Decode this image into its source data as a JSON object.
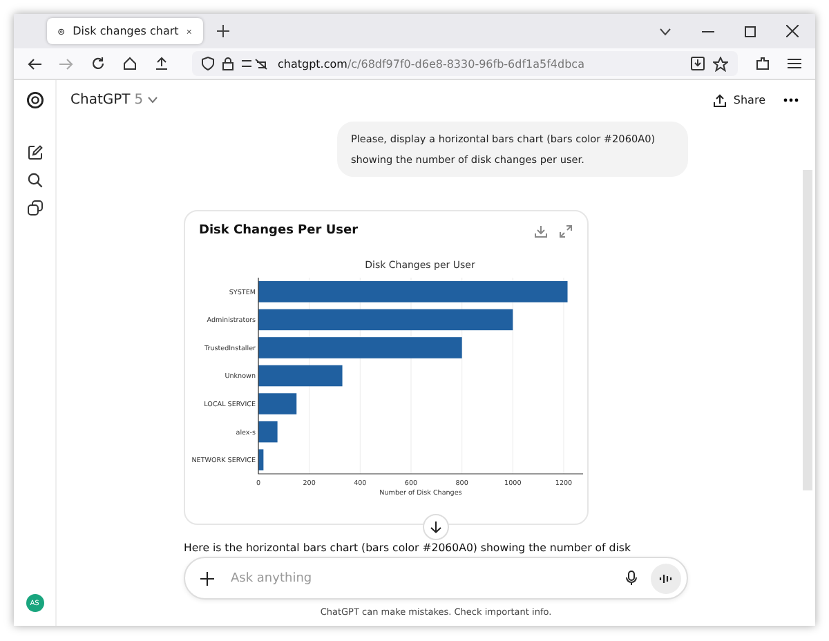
{
  "browser": {
    "tabs": [
      {
        "title": "Disk changes chart",
        "selected": true
      }
    ],
    "url_host": "chatgpt.com",
    "url_path": "/c/68df97f0-d6e8-8330-96fb-6df1a5f4dbca"
  },
  "header": {
    "app_name": "ChatGPT",
    "model": "5",
    "share": "Share"
  },
  "user_message": "Please, display a horizontal bars chart (bars color #2060A0) showing the number of disk changes per user.",
  "card": {
    "title": "Disk Changes Per User",
    "chart_data": {
      "type": "bar",
      "orientation": "horizontal",
      "title": "Disk Changes per User",
      "xlabel": "Number of Disk Changes",
      "categories": [
        "SYSTEM",
        "Administrators",
        "TrustedInstaller",
        "Unknown",
        "LOCAL SERVICE",
        "alex-s",
        "NETWORK SERVICE"
      ],
      "series": [
        {
          "color": "#2060a0",
          "values": [
            1215,
            1000,
            800,
            330,
            150,
            75,
            20
          ]
        }
      ],
      "grid": true,
      "xlim": [
        0,
        1276
      ],
      "xticks": [
        0,
        200,
        400,
        600,
        800,
        1000,
        1200
      ]
    }
  },
  "assistant_message": "Here is the horizontal bars chart (bars color #2060A0) showing the number of disk",
  "composer": {
    "placeholder": "Ask anything"
  },
  "avatar": "AS",
  "disclaimer": "ChatGPT can make mistakes. Check important info."
}
